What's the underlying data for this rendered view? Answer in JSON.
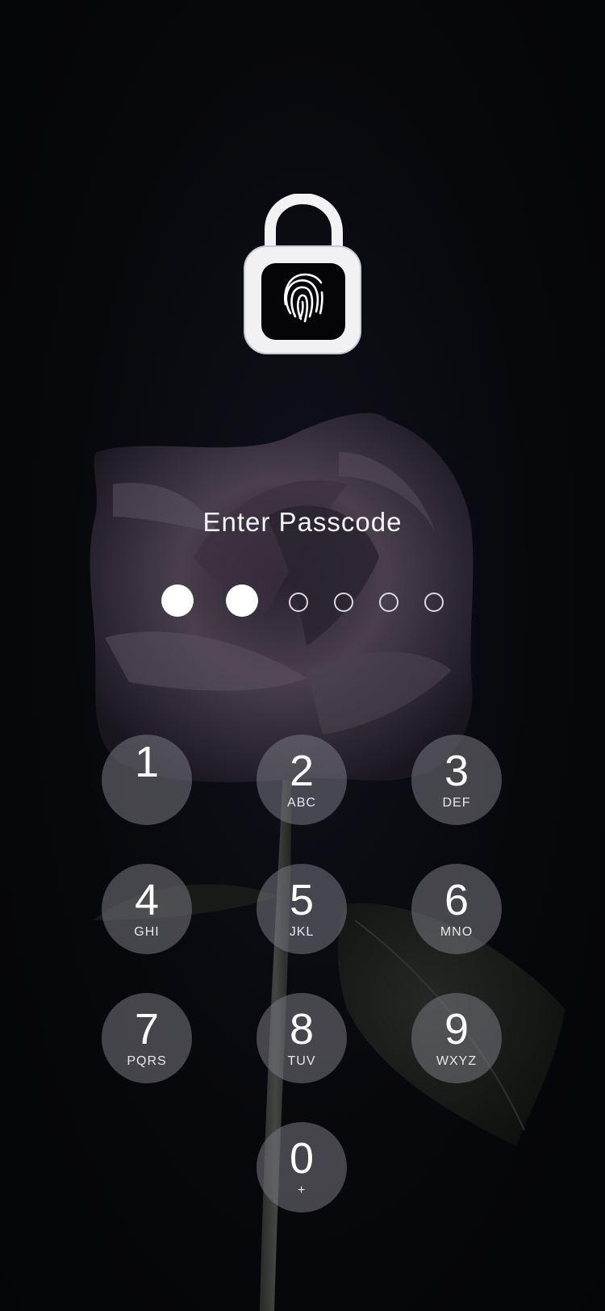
{
  "lock_screen": {
    "title": "Enter Passcode",
    "passcode_length": 6,
    "digits_entered": 2,
    "accent_color": "#ffffff",
    "lock_icon": "unlocked-padlock-fingerprint-icon"
  },
  "keypad": {
    "keys": [
      {
        "digit": "1",
        "letters": ""
      },
      {
        "digit": "2",
        "letters": "ABC"
      },
      {
        "digit": "3",
        "letters": "DEF"
      },
      {
        "digit": "4",
        "letters": "GHI"
      },
      {
        "digit": "5",
        "letters": "JKL"
      },
      {
        "digit": "6",
        "letters": "MNO"
      },
      {
        "digit": "7",
        "letters": "PQRS"
      },
      {
        "digit": "8",
        "letters": "TUV"
      },
      {
        "digit": "9",
        "letters": "WXYZ"
      },
      {
        "digit": "0",
        "letters": "+"
      }
    ]
  }
}
